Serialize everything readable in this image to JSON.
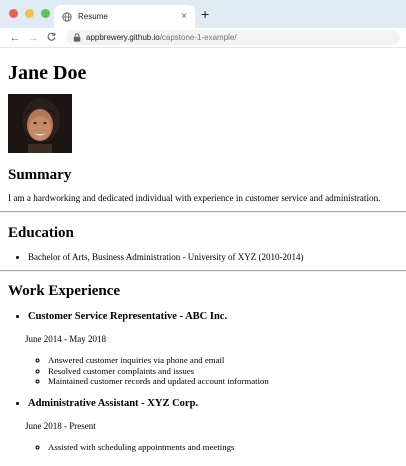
{
  "browser": {
    "tab_title": "Resume",
    "tab_close": "×",
    "new_tab": "+",
    "url_host": "appbrewery.github.io",
    "url_path": "/capstone-1-example/",
    "back": "←",
    "forward": "→",
    "reload": "C"
  },
  "resume": {
    "name": "Jane Doe",
    "summary": {
      "heading": "Summary",
      "text": "I am a hardworking and dedicated individual with experience in customer service and administration."
    },
    "education": {
      "heading": "Education",
      "items": [
        "Bachelor of Arts, Business Administration - University of XYZ (2010-2014)"
      ]
    },
    "work": {
      "heading": "Work Experience",
      "jobs": [
        {
          "title": "Customer Service Representative - ABC Inc.",
          "dates": "June 2014 - May 2018",
          "duties": [
            "Answered customer inquiries via phone and email",
            "Resolved customer complaints and issues",
            "Maintained customer records and updated account information"
          ]
        },
        {
          "title": "Administrative Assistant - XYZ Corp.",
          "dates": "June 2018 - Present",
          "duties": [
            "Assisted with scheduling appointments and meetings"
          ]
        }
      ]
    }
  }
}
